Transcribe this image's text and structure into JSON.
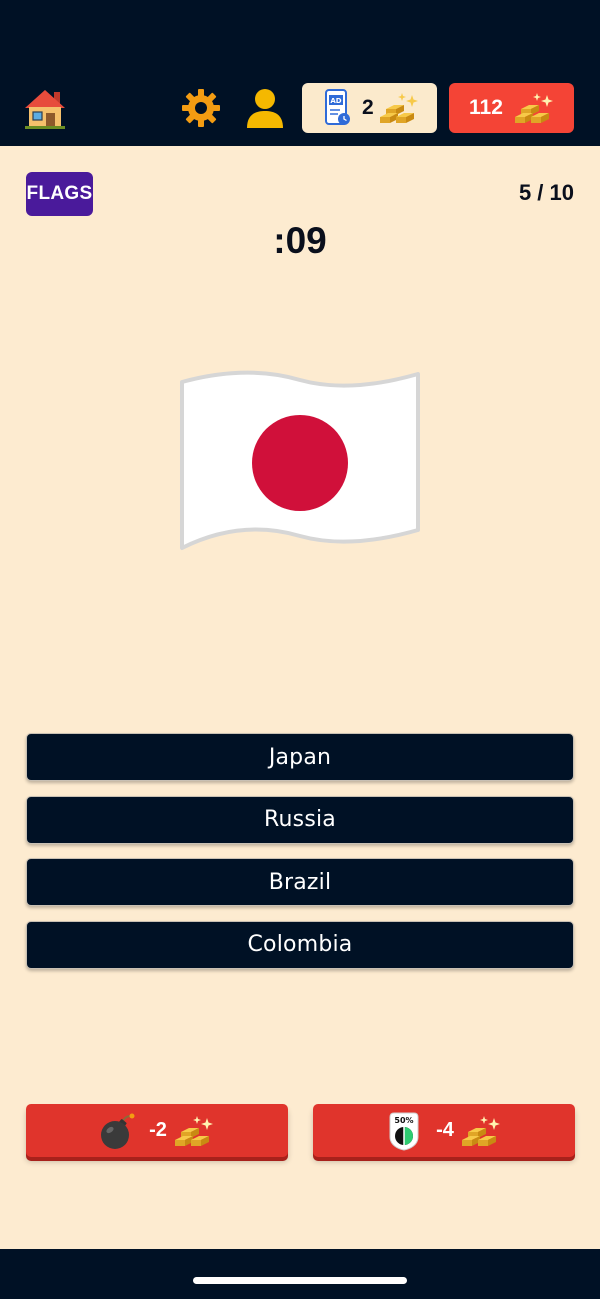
{
  "header": {
    "home_icon": "house-icon",
    "settings_icon": "gear-icon",
    "profile_icon": "person-icon",
    "ad_reward": {
      "icon": "ad-phone-icon",
      "count": "2",
      "currency_icon": "gold-bars-icon"
    },
    "coins": {
      "count": "112",
      "currency_icon": "gold-bars-icon"
    }
  },
  "quiz": {
    "category": "FLAGS",
    "progress": "5 / 10",
    "timer": ":09",
    "flag_icon": "japan-flag",
    "answers": [
      "Japan",
      "Russia",
      "Brazil",
      "Colombia"
    ]
  },
  "powerups": {
    "bomb": {
      "icon": "bomb-icon",
      "cost": "-2",
      "currency_icon": "gold-bars-icon"
    },
    "fifty_fifty": {
      "icon": "fifty-fifty-icon",
      "label": "50%",
      "cost": "-4",
      "currency_icon": "gold-bars-icon"
    }
  },
  "colors": {
    "navy": "#001125",
    "cream": "#fdebd0",
    "red": "#f44436",
    "purple": "#4a1a9b",
    "japan_red": "#d0103a"
  }
}
